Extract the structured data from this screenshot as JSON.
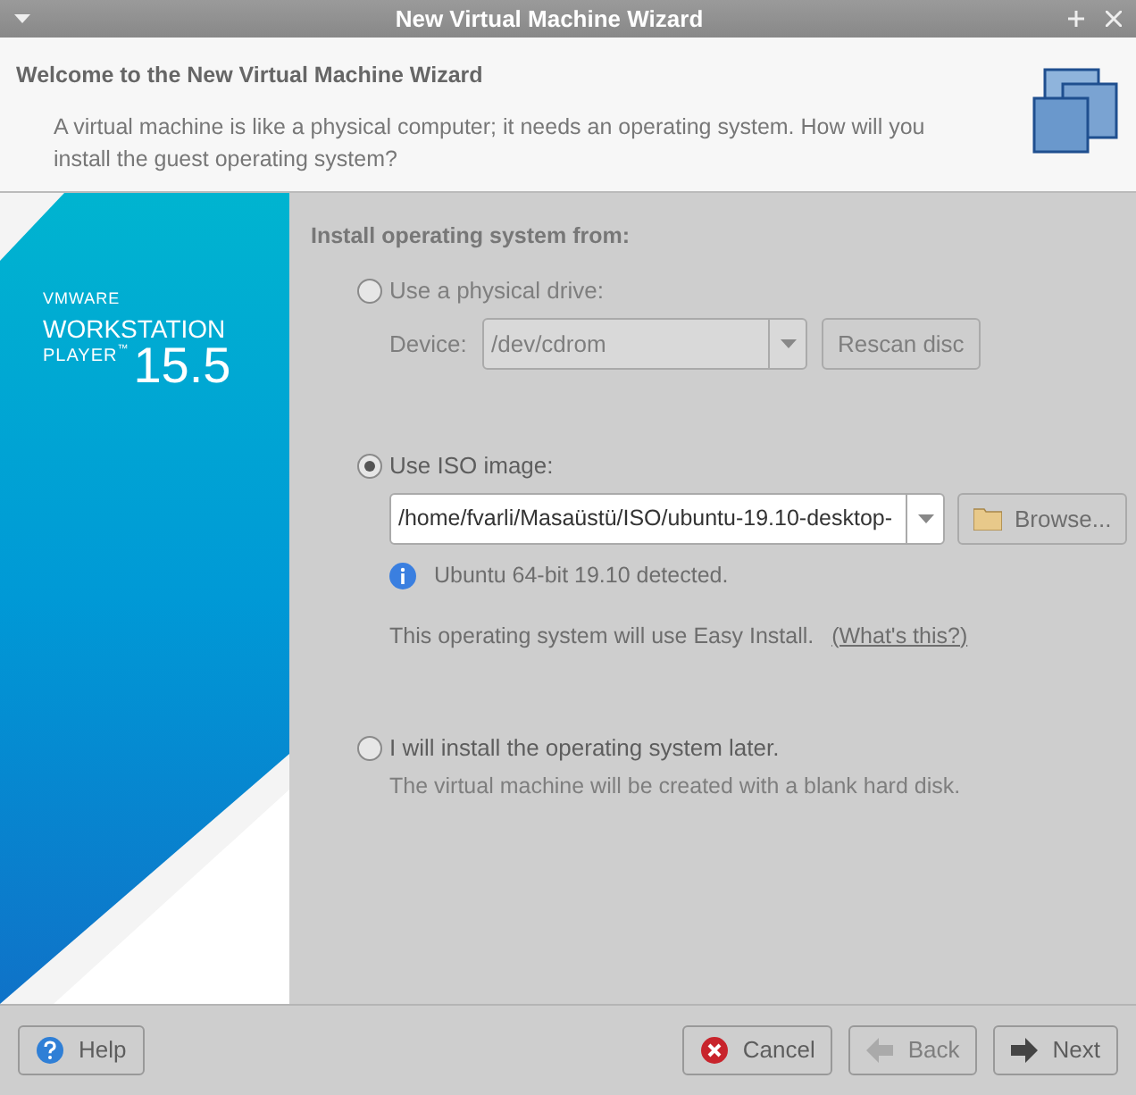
{
  "window": {
    "title": "New Virtual Machine Wizard"
  },
  "header": {
    "title": "Welcome to the New Virtual Machine Wizard",
    "description": "A virtual machine is like a physical computer; it needs an operating system. How will you install the guest operating system?"
  },
  "brand": {
    "company": "VMWARE",
    "product": "WORKSTATION",
    "edition": "PLAYER",
    "trademark": "™",
    "version": "15.5"
  },
  "section_label": "Install operating system from:",
  "options": [
    {
      "kind": "drive",
      "label": "Use a physical drive:",
      "selected": false,
      "device_label": "Device:",
      "device": "/dev/cdrom",
      "disabled": true,
      "button": "Rescan disc"
    },
    {
      "kind": "iso",
      "label": "Use ISO image:",
      "selected": true,
      "path": "/home/fvarli/Masaüstü/ISO/ubuntu-19.10-desktop-",
      "button": "Browse...",
      "detected": "Ubuntu 64-bit 19.10 detected.",
      "note": "This operating system will use Easy Install.",
      "link": "(What's this?)"
    },
    {
      "kind": "later",
      "label": "I will install the operating system later.",
      "selected": false,
      "note": "The virtual machine will be created with a blank hard disk."
    }
  ],
  "buttons": [
    {
      "kind": "help",
      "label": "Help",
      "disabled": false
    },
    {
      "kind": "cancel",
      "label": "Cancel",
      "disabled": false
    },
    {
      "kind": "back",
      "label": "Back",
      "disabled": true
    },
    {
      "kind": "next",
      "label": "Next",
      "disabled": false
    }
  ]
}
